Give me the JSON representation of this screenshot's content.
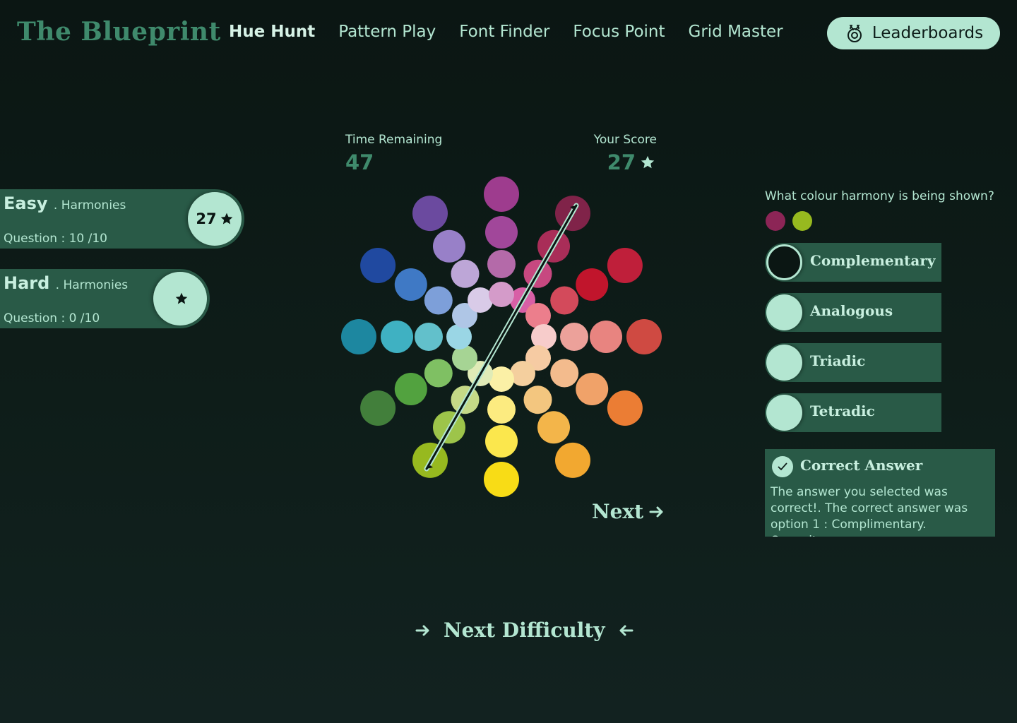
{
  "app": {
    "logo": "The Blueprint"
  },
  "nav": {
    "items": [
      {
        "label": "Hue Hunt",
        "active": true
      },
      {
        "label": "Pattern Play",
        "active": false
      },
      {
        "label": "Font Finder",
        "active": false
      },
      {
        "label": "Focus Point",
        "active": false
      },
      {
        "label": "Grid Master",
        "active": false
      }
    ],
    "leaderboards_label": "Leaderboards",
    "leaderboards_icon": "medal-icon"
  },
  "difficulties": [
    {
      "name": "Easy",
      "category": ". Harmonies",
      "progress": "Question : 10 /10",
      "score": "27",
      "icon": "star-icon"
    },
    {
      "name": "Hard",
      "category": ". Harmonies",
      "progress": "Question : 0 /10",
      "score": "",
      "icon": "star-icon"
    }
  ],
  "game": {
    "time_label": "Time Remaining",
    "time_value": "47",
    "score_label": "Your Score",
    "score_value": "27",
    "next_label": "Next",
    "next_difficulty_label": "Next Difficulty"
  },
  "question": {
    "prompt": "What colour harmony is being shown?",
    "swatches": [
      "#8c2556",
      "#97b91f"
    ],
    "options": [
      {
        "label": "Complementary",
        "selected": true
      },
      {
        "label": "Analogous",
        "selected": false
      },
      {
        "label": "Triadic",
        "selected": false
      },
      {
        "label": "Tetradic",
        "selected": false
      }
    ]
  },
  "feedback": {
    "title": "Correct Answer",
    "body": "The answer you selected was correct!. The correct answer was option 1 : Complimentary. Opposite"
  },
  "colors": {
    "accent": "#b3e6d1",
    "panel": "#295a47",
    "logo": "#3f8a6c",
    "background": "#0e1d19"
  },
  "wheel": {
    "spokes": [
      {
        "hue": "red-violet",
        "colors": [
          "#802349",
          "#a92d58",
          "#c74880",
          "#d85fa6"
        ]
      },
      {
        "hue": "red",
        "colors": [
          "#bf1f3a",
          "#c1152c",
          "#d34a5b",
          "#ec7e8c"
        ]
      },
      {
        "hue": "red-orange",
        "colors": [
          "#cf4a42",
          "#e88480",
          "#eca19a",
          "#f7cccb"
        ]
      },
      {
        "hue": "orange",
        "colors": [
          "#eb7d34",
          "#f0a269",
          "#f3bb8d",
          "#f6cba3"
        ]
      },
      {
        "hue": "yellow-orange",
        "colors": [
          "#f2a830",
          "#f3b54a",
          "#f3c67f",
          "#f4cf9e"
        ]
      },
      {
        "hue": "yellow",
        "colors": [
          "#f8dc16",
          "#fbe74d",
          "#fceb80",
          "#fbf0a6"
        ]
      },
      {
        "hue": "yellow-green",
        "colors": [
          "#97b91f",
          "#9dc44a",
          "#c5d987",
          "#e0ebb7"
        ]
      },
      {
        "hue": "green",
        "colors": [
          "#427f3b",
          "#52a23f",
          "#7fc063",
          "#a6d494"
        ]
      },
      {
        "hue": "blue-green",
        "colors": [
          "#1d87a0",
          "#3fb1c2",
          "#62c0cb",
          "#9ad6e5"
        ]
      },
      {
        "hue": "blue",
        "colors": [
          "#2049a0",
          "#3f79c5",
          "#7d9fd9",
          "#afc6e6"
        ]
      },
      {
        "hue": "blue-violet",
        "colors": [
          "#6b4a9f",
          "#9880c8",
          "#bda6d7",
          "#d9cbe8"
        ]
      },
      {
        "hue": "violet",
        "colors": [
          "#9e3c8e",
          "#a1479a",
          "#b46aa9",
          "#d49bc9"
        ]
      }
    ]
  }
}
